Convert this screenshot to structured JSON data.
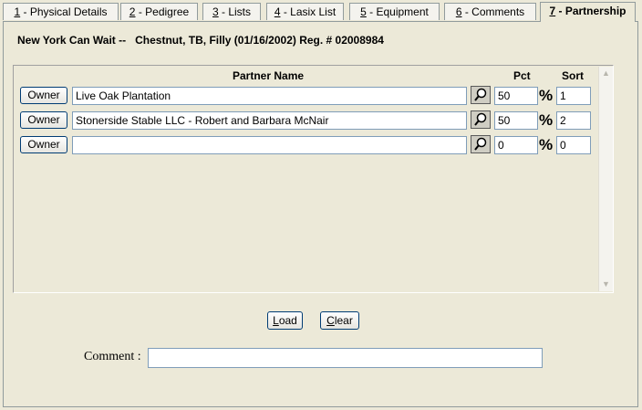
{
  "tabs": [
    {
      "key": "1",
      "label": " - Physical Details"
    },
    {
      "key": "2",
      "label": " - Pedigree"
    },
    {
      "key": "3",
      "label": " - Lists"
    },
    {
      "key": "4",
      "label": " - Lasix List"
    },
    {
      "key": "5",
      "label": " - Equipment"
    },
    {
      "key": "6",
      "label": " - Comments"
    },
    {
      "key": "7",
      "label": " - Partnership"
    }
  ],
  "active_tab": "7",
  "header": {
    "horse_name": "New York Can Wait --",
    "details": "Chestnut, TB, Filly (01/16/2002) Reg. # 02008984"
  },
  "columns": {
    "partner_name": "Partner Name",
    "pct": "Pct",
    "sort": "Sort"
  },
  "rows": [
    {
      "button": "Owner",
      "name": "Live Oak Plantation",
      "pct": "50",
      "pct_symbol": "%",
      "sort": "1"
    },
    {
      "button": "Owner",
      "name": "Stonerside Stable LLC - Robert and Barbara McNair",
      "pct": "50",
      "pct_symbol": "%",
      "sort": "2"
    },
    {
      "button": "Owner",
      "name": "",
      "pct": "0",
      "pct_symbol": "%",
      "sort": "0"
    }
  ],
  "buttons": {
    "load_key": "L",
    "load_rest": "oad",
    "clear_key": "C",
    "clear_rest": "lear"
  },
  "comment": {
    "label": "Comment :",
    "value": ""
  }
}
